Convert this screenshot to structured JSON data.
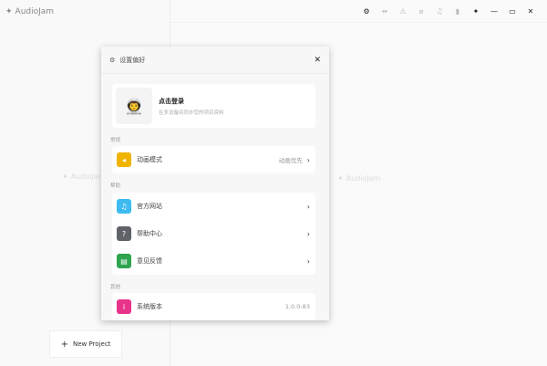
{
  "app": {
    "name": "AudioJam",
    "watermark": "AudioJam"
  },
  "titlebar": {
    "icons": [
      "gear-icon",
      "swap-icon",
      "warning-icon",
      "attachment-icon",
      "music-icon",
      "bookmark-icon",
      "pin-icon",
      "minimize-icon",
      "maximize-icon",
      "close-icon"
    ]
  },
  "sidebar": {
    "new_project": "New Project"
  },
  "modal": {
    "title": "设置偏好",
    "login": {
      "title": "点击登录",
      "subtitle": "在多设备间同步您的项目资料"
    },
    "sections": [
      {
        "label": "常规",
        "items": [
          {
            "label": "动画模式",
            "value": "动画优先",
            "color": "#f0b400",
            "icon": "animation-icon"
          }
        ]
      },
      {
        "label": "帮助",
        "items": [
          {
            "label": "官方网站",
            "color": "#3dbbf0",
            "icon": "music-note-icon"
          },
          {
            "label": "帮助中心",
            "color": "#5f6368",
            "icon": "question-icon"
          },
          {
            "label": "意见反馈",
            "color": "#2ea44f",
            "icon": "feedback-icon"
          }
        ]
      },
      {
        "label": "其他",
        "items": [
          {
            "label": "系统版本",
            "value": "1.0.0-83",
            "color": "#e8338a",
            "icon": "info-icon"
          }
        ]
      }
    ]
  }
}
